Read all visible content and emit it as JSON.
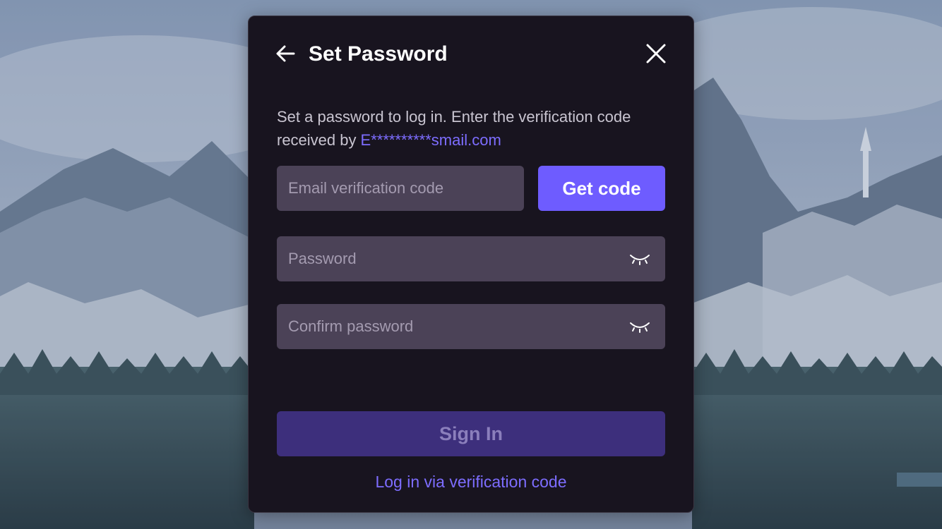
{
  "dialog": {
    "title": "Set Password",
    "description": "Set a password to log in. Enter the verification code received by",
    "masked_email": "E**********smail.com",
    "code_field": {
      "placeholder": "Email verification code",
      "value": ""
    },
    "get_code_label": "Get code",
    "password_field": {
      "placeholder": "Password",
      "value": ""
    },
    "confirm_field": {
      "placeholder": "Confirm password",
      "value": ""
    },
    "sign_in_label": "Sign In",
    "alt_login_label": "Log in via verification code"
  },
  "colors": {
    "accent": "#6e5cff",
    "link": "#7d6dff",
    "panel": "#18141f",
    "field": "#4b4257",
    "disabled_button": "#3d2f7c"
  },
  "icons": {
    "back": "arrow-left-icon",
    "close": "close-icon",
    "password_visibility": "eye-closed-icon"
  }
}
